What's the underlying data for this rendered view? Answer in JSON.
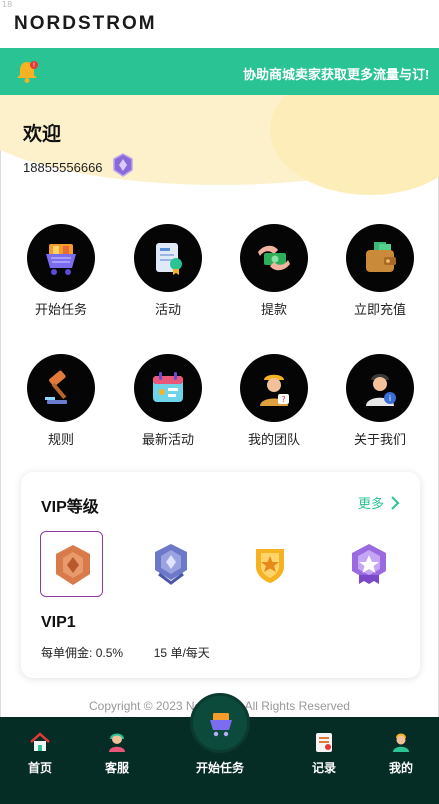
{
  "corner_tag": "18",
  "brand": {
    "logo_text": "NORDSTROM"
  },
  "notice": {
    "text": "协助商城卖家获取更多流量与订!",
    "color": "#2ac393"
  },
  "user": {
    "greeting": "欢迎",
    "phone": "18855556666"
  },
  "grid_row1": [
    {
      "label": "开始任务",
      "icon": "cart-icon"
    },
    {
      "label": "活动",
      "icon": "certificate-icon"
    },
    {
      "label": "提款",
      "icon": "cash-hand-icon"
    },
    {
      "label": "立即充值",
      "icon": "wallet-icon"
    }
  ],
  "grid_row2": [
    {
      "label": "规则",
      "icon": "gavel-icon"
    },
    {
      "label": "最新活动",
      "icon": "calendar-icon"
    },
    {
      "label": "我的团队",
      "icon": "team-worker-icon"
    },
    {
      "label": "关于我们",
      "icon": "about-person-icon"
    }
  ],
  "vip": {
    "title": "VIP等级",
    "more_label": "更多",
    "current_level": "VIP1",
    "commission_label": "每单佣金:",
    "commission_value": "0.5%",
    "orders_count": "15",
    "orders_unit": "单/每天",
    "badges": [
      "bronze-badge-icon",
      "silver-badge-icon",
      "gold-badge-icon",
      "purple-badge-icon"
    ],
    "selected_index": 0
  },
  "footer": {
    "copyright": "Copyright © 2023 Nordstrom All Rights Reserved"
  },
  "tabbar": {
    "home": "首页",
    "service": "客服",
    "start": "开始任务",
    "records": "记录",
    "mine": "我的"
  },
  "colors": {
    "accent": "#2ac393",
    "tabbar_bg": "#052d25",
    "vip_select": "#8e3aa5"
  }
}
